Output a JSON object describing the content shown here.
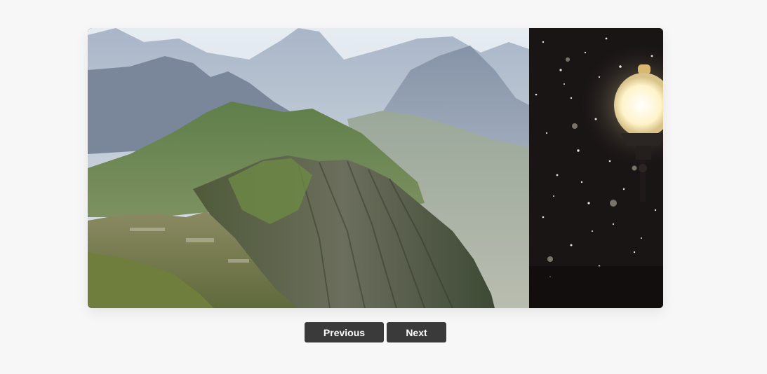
{
  "carousel": {
    "slides": [
      {
        "image": "mountain-ridge-landscape"
      },
      {
        "image": "street-lamp-at-night-snow"
      }
    ]
  },
  "controls": {
    "previous_label": "Previous",
    "next_label": "Next"
  },
  "colors": {
    "page_background": "#f7f7f7",
    "button_background": "#3a3a3a",
    "button_text": "#ffffff"
  }
}
